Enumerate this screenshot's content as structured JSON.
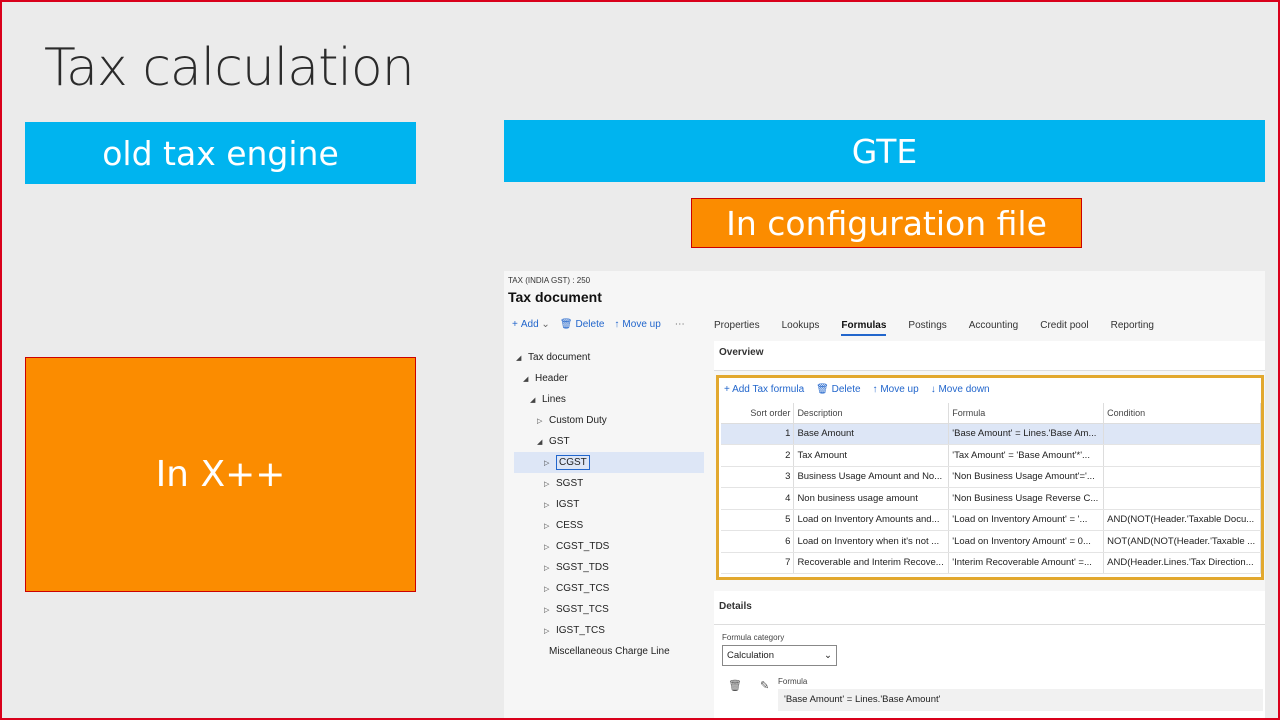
{
  "slide": {
    "title": "Tax calculation",
    "old_engine": "old tax engine",
    "gte": "GTE",
    "config_file": "In configuration file",
    "xpp": "In X++"
  },
  "app": {
    "breadcrumb": "TAX (INDIA GST) : 250",
    "title": "Tax document",
    "toolbar": {
      "add": "Add",
      "delete": "Delete",
      "move_up": "Move up",
      "more": "⋯"
    },
    "tabs": [
      "Properties",
      "Lookups",
      "Formulas",
      "Postings",
      "Accounting",
      "Credit pool",
      "Reporting"
    ],
    "active_tab": "Formulas",
    "tree": [
      {
        "label": "Tax document"
      },
      {
        "label": "Header"
      },
      {
        "label": "Lines"
      },
      {
        "label": "Custom Duty"
      },
      {
        "label": "GST"
      },
      {
        "label": "CGST"
      },
      {
        "label": "SGST"
      },
      {
        "label": "IGST"
      },
      {
        "label": "CESS"
      },
      {
        "label": "CGST_TDS"
      },
      {
        "label": "SGST_TDS"
      },
      {
        "label": "CGST_TCS"
      },
      {
        "label": "SGST_TCS"
      },
      {
        "label": "IGST_TCS"
      },
      {
        "label": "Miscellaneous Charge Line"
      }
    ],
    "overview": {
      "label": "Overview",
      "toolbar": {
        "add": "Add Tax formula",
        "delete": "Delete",
        "move_up": "Move up",
        "move_down": "Move down"
      },
      "columns": [
        "Sort order",
        "Description",
        "Formula",
        "Condition"
      ],
      "rows": [
        {
          "order": "1",
          "description": "Base Amount",
          "formula": "'Base Amount' = Lines.'Base Am...",
          "condition": ""
        },
        {
          "order": "2",
          "description": "Tax Amount",
          "formula": "'Tax Amount' = 'Base Amount'*'...",
          "condition": ""
        },
        {
          "order": "3",
          "description": "Business Usage Amount and No...",
          "formula": "'Non Business Usage Amount'='...",
          "condition": ""
        },
        {
          "order": "4",
          "description": "Non business usage amount",
          "formula": "'Non Business Usage Reverse C...",
          "condition": ""
        },
        {
          "order": "5",
          "description": "Load on Inventory Amounts and...",
          "formula": "'Load on Inventory Amount' = '...",
          "condition": "AND(NOT(Header.'Taxable Docu..."
        },
        {
          "order": "6",
          "description": "Load on Inventory when it's not ...",
          "formula": "'Load on Inventory Amount' = 0...",
          "condition": "NOT(AND(NOT(Header.'Taxable ..."
        },
        {
          "order": "7",
          "description": "Recoverable and Interim Recove...",
          "formula": "'Interim Recoverable Amount' =...",
          "condition": "AND(Header.Lines.'Tax Direction..."
        }
      ]
    },
    "details": {
      "label": "Details",
      "category_label": "Formula category",
      "category_value": "Calculation",
      "formula_label": "Formula",
      "formula_value": "'Base Amount' = Lines.'Base Amount'"
    }
  }
}
